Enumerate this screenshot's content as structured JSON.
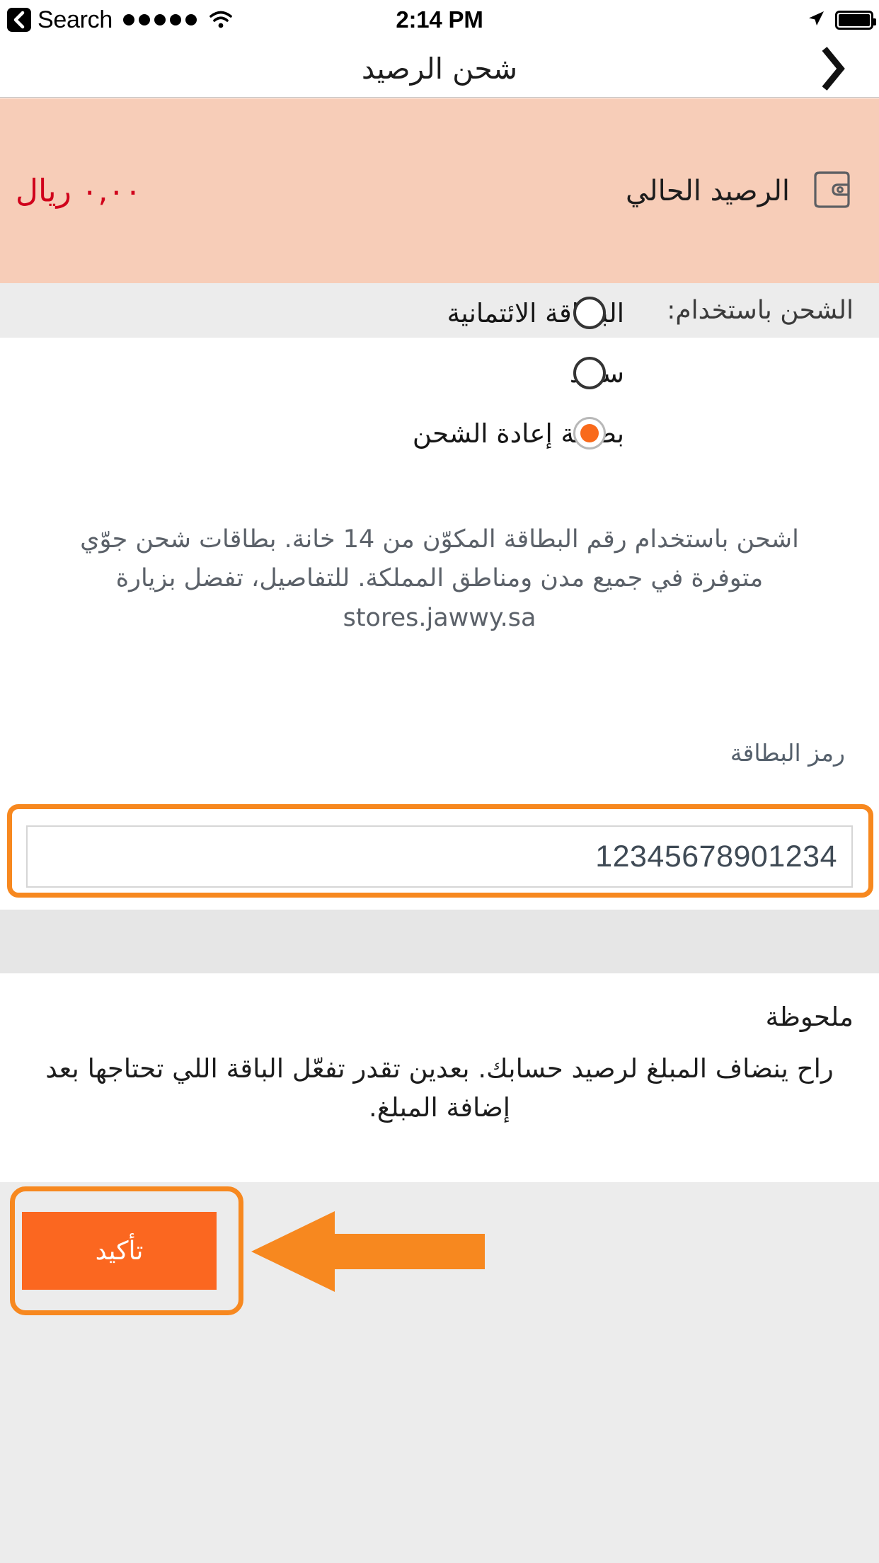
{
  "status_bar": {
    "back_label": "Search",
    "back_icon": "chevron-left-icon",
    "signal_dots": 5,
    "wifi_icon": "wifi-icon",
    "time": "2:14 PM",
    "location_icon": "location-arrow-icon",
    "battery_icon": "battery-full-icon"
  },
  "nav": {
    "title": "شحن الرصيد",
    "back_icon": "chevron-right-icon"
  },
  "balance": {
    "icon": "wallet-icon",
    "label": "الرصيد الحالي",
    "amount": "٠,٠٠ ريال",
    "bg_color": "#F7CDB8",
    "amount_color": "#D0021B"
  },
  "payment_section": {
    "header": "الشحن باستخدام:",
    "options": [
      {
        "label": "البطاقة الائتمانية",
        "selected": false
      },
      {
        "label": "سداد",
        "selected": false
      },
      {
        "label": "بطاقة إعادة الشحن",
        "selected": true
      }
    ],
    "selected_color": "#F96A1B"
  },
  "description": "اشحن باستخدام رقم البطاقة المكوّن من 14 خانة. بطاقات شحن جوّي متوفرة في جميع مدن ومناطق المملكة. للتفاصيل، تفضل بزيارة stores.jawwy.sa",
  "card_field": {
    "label": "رمز البطاقة",
    "value": "12345678901234",
    "placeholder": "رمز البطاقة"
  },
  "note": {
    "title": "ملحوظة",
    "body": "راح ينضاف المبلغ لرصيد حسابك. بعدين تقدر تفعّل الباقة اللي تحتاجها بعد إضافة المبلغ."
  },
  "footer": {
    "confirm_label": "تأكيد",
    "confirm_color": "#FB6720"
  },
  "annotations": {
    "highlight_color": "#F7881F",
    "field_box": "card-code-highlight",
    "button_box": "confirm-button-highlight",
    "arrow": "pointer-arrow-left"
  }
}
